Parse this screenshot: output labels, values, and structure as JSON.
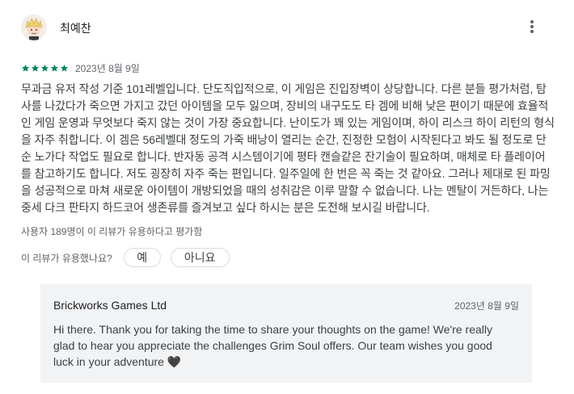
{
  "review": {
    "author": "최예찬",
    "rating": 5,
    "max_rating": 5,
    "star_color": "#01875f",
    "date": "2023년 8월 9일",
    "text": "무과금 유저 작성 기준 101레벨입니다. 단도직입적으로, 이 게임은 진입장벽이 상당합니다. 다른 분들 평가처럼, 탐사를 나갔다가 죽으면 가지고 갔던 아이템을 모두 잃으며, 장비의 내구도도 타 겜에 비해 낮은 편이기 때문에 효율적인 게임 운영과 무엇보다 죽지 않는 것이 가장 중요합니다. 난이도가 꽤 있는 게임이며, 하이 리스크 하이 리턴의 형식을 자주 취합니다. 이 겜은 56레벨대 정도의 가죽 배낭이 열리는 순간, 진정한 모험이 시작된다고 봐도 될 정도로 단순 노가다 작업도 필요로 합니다. 반자동 공격 시스템이기에 평타 캔슬같은 잔기술이 필요하며, 매체로 타 플레이어를 참고하기도 합니다. 저도 굉장히 자주 죽는 편입니다. 일주일에 한 번은 꼭 죽는 것 같아요. 그러나 제대로 된 파밍을 성공적으로 마쳐 새로운 아이템이 개방되었을 때의 성취감은 이루 말할 수 없습니다. 나는 멘탈이 거든하다, 나는 중세 다크 판타지 하드코어 생존류를 즐겨보고 싶다 하시는 분은 도전해 보시길 바랍니다.",
    "helpful_count_text": "사용자 189명이 이 리뷰가 유용하다고 평가함",
    "helpful_question": "이 리뷰가 유용했나요?",
    "yes_label": "예",
    "no_label": "아니요",
    "more_icon": "more-vert-icon"
  },
  "developer_reply": {
    "author": "Brickworks Games Ltd",
    "date": "2023년 8월 9일",
    "text": "Hi there. Thank you for taking the time to share your thoughts on the game! We're really glad to hear you appreciate the challenges Grim Soul offers. Our team wishes you good luck in your adventure 🖤"
  }
}
